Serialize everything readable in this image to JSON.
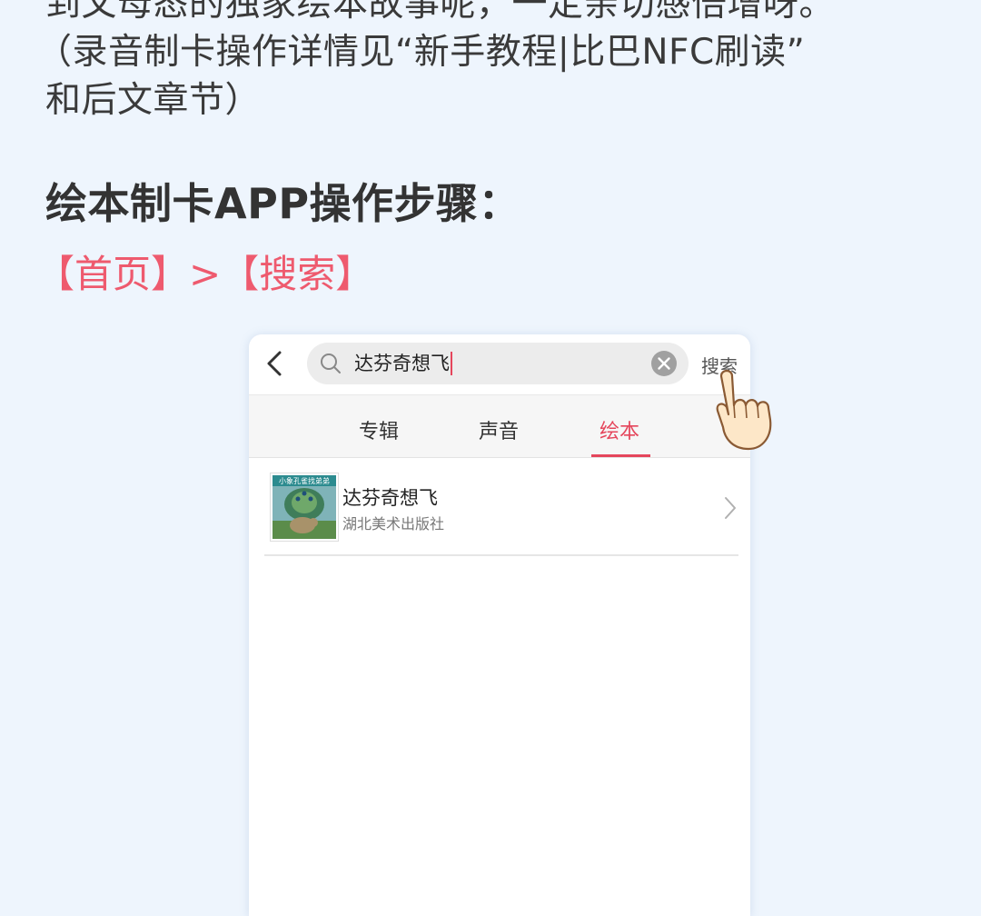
{
  "intro": {
    "line1": "到父母态的独家绘本故事呢，一定亲切感倍增呀。",
    "line2": "（录音制卡操作详情见“新手教程|比巴NFC刷读”",
    "line3": "和后文章节）"
  },
  "heading": "绘本制卡APP操作步骤：",
  "breadcrumb": "【首页】>【搜索】",
  "app": {
    "search_query": "达芬奇想飞",
    "search_button": "搜索",
    "tabs": [
      {
        "label": "专辑",
        "active": false
      },
      {
        "label": "声音",
        "active": false
      },
      {
        "label": "绘本",
        "active": true
      }
    ],
    "results": [
      {
        "title": "达芬奇想飞",
        "publisher": "湖北美术出版社"
      }
    ],
    "cover_text": "小象孔雀找弟弟"
  },
  "colors": {
    "accent": "#e5465c",
    "breadcrumb": "#ee5a6e",
    "background": "#eef5fd"
  },
  "icons": [
    "back-arrow-icon",
    "search-icon",
    "clear-icon",
    "chevron-right-icon",
    "pointing-hand-icon"
  ]
}
